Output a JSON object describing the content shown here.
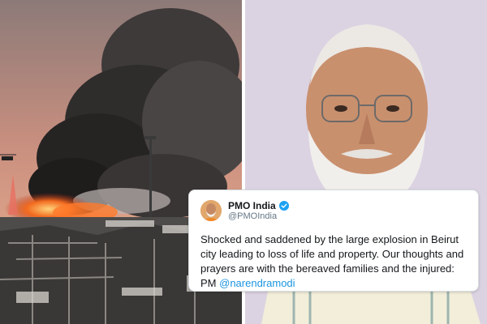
{
  "left_photo": {
    "subject": "explosion-scene"
  },
  "right_photo": {
    "subject": "portrait"
  },
  "tweet": {
    "account_name": "PMO India",
    "account_handle": "@PMOIndia",
    "verified": true,
    "text": "Shocked and saddened by the large explosion in Beirut city leading to loss of life and property. Our thoughts and prayers are with the bereaved families and the injured: PM ",
    "mention": "@narendramodi"
  },
  "colors": {
    "mention": "#1b95e0",
    "verified": "#1da1f2",
    "text": "#14171a",
    "handle": "#657786",
    "right_background": "#dcd3e2"
  }
}
